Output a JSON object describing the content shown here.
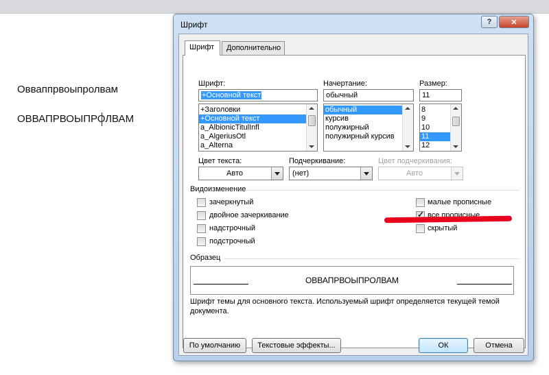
{
  "document": {
    "line1": "Овваппрвоыпролвам",
    "line2": "ОВВАПРВОЫПРОЛВАМ"
  },
  "dialog": {
    "title": "Шрифт",
    "help_glyph": "?",
    "close_glyph": "✕",
    "tabs": [
      {
        "label": "Шрифт",
        "active": true
      },
      {
        "label": "Дополнительно",
        "active": false
      }
    ],
    "font": {
      "label": "Шрифт:",
      "value": "+Основной текст",
      "items": [
        "+Заголовки",
        "+Основной текст",
        "a_AlbionicTitulInfl",
        "a_AlgeriusOtl",
        "a_Alterna"
      ],
      "selected_index": 1
    },
    "style": {
      "label": "Начертание:",
      "value": "обычный",
      "items": [
        "обычный",
        "курсив",
        "полужирный",
        "полужирный курсив"
      ],
      "selected_index": 0
    },
    "size": {
      "label": "Размер:",
      "value": "11",
      "items": [
        "8",
        "9",
        "10",
        "11",
        "12"
      ],
      "selected_index": 3
    },
    "font_color": {
      "label": "Цвет текста:",
      "value": "Авто"
    },
    "underline": {
      "label": "Подчеркивание:",
      "value": "(нет)"
    },
    "underline_color": {
      "label": "Цвет подчеркивания:",
      "value": "Авто",
      "disabled": true
    },
    "effects": {
      "title": "Видоизменение",
      "strikethrough": {
        "label": "зачеркнутый",
        "checked": false
      },
      "double_strikethrough": {
        "label": "двойное зачеркивание",
        "checked": false
      },
      "superscript": {
        "label": "надстрочный",
        "checked": false
      },
      "subscript": {
        "label": "подстрочный",
        "checked": false
      },
      "small_caps": {
        "label": "малые прописные",
        "checked": false
      },
      "all_caps": {
        "label": "все прописные",
        "checked": true
      },
      "hidden": {
        "label": "скрытый",
        "checked": false
      }
    },
    "preview": {
      "title": "Образец",
      "text": "ОВВАПРВОЫПРОЛВАМ",
      "note": "Шрифт темы для основного текста. Используемый шрифт определяется текущей темой документа."
    },
    "buttons": {
      "default": "По умолчанию",
      "text_effects": "Текстовые эффекты...",
      "ok": "ОК",
      "cancel": "Отмена"
    }
  },
  "colors": {
    "selection": "#3399ff",
    "annotation_mark": "#e8001c",
    "dialog_frame": "#b9d0ea"
  }
}
